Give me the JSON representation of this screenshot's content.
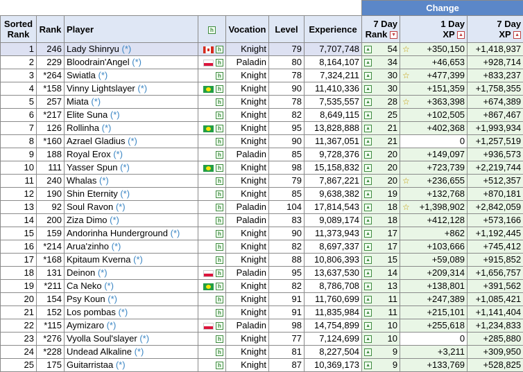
{
  "header": {
    "change": "Change",
    "sorted_rank": [
      "Sorted",
      "Rank"
    ],
    "rank": "Rank",
    "player": "Player",
    "vocation": "Vocation",
    "level": "Level",
    "experience": "Experience",
    "day7_rank": [
      "7 Day",
      "Rank"
    ],
    "day1_xp": [
      "1 Day",
      "XP"
    ],
    "day7_xp": [
      "7 Day",
      "XP"
    ]
  },
  "icons": {
    "highscore": "h-icon",
    "up": "up-arrow-icon",
    "sort": "sort-icon",
    "star": "star-icon"
  },
  "colors": {
    "change_header": "#5b87c8",
    "header_bg": "#dfe7f5",
    "selected_row": "#dde1f2",
    "green_cell": "#e9f6e6",
    "link": "#3b86c4"
  },
  "rows": [
    {
      "srank": "1",
      "rank": "246",
      "player": "Lady Shinryu",
      "star_link": "(*)",
      "flag": "ca",
      "vocation": "Knight",
      "level": "79",
      "exp": "7,707,748",
      "r7": "54",
      "star1": true,
      "xp1": "+350,150",
      "xp7": "+1,418,937",
      "sel": true
    },
    {
      "srank": "2",
      "rank": "229",
      "player": "Bloodrain'Angel",
      "star_link": "(*)",
      "flag": "pl",
      "vocation": "Paladin",
      "level": "80",
      "exp": "8,164,107",
      "r7": "34",
      "star1": false,
      "xp1": "+46,653",
      "xp7": "+928,714"
    },
    {
      "srank": "3",
      "rank": "*264",
      "player": "Swiatla",
      "star_link": "(*)",
      "flag": "",
      "vocation": "Knight",
      "level": "78",
      "exp": "7,324,211",
      "r7": "30",
      "star1": true,
      "xp1": "+477,399",
      "xp7": "+833,237"
    },
    {
      "srank": "4",
      "rank": "*158",
      "player": "Vinny Lightslayer",
      "star_link": "(*)",
      "flag": "br",
      "vocation": "Knight",
      "level": "90",
      "exp": "11,410,336",
      "r7": "30",
      "star1": false,
      "xp1": "+151,359",
      "xp7": "+1,758,355"
    },
    {
      "srank": "5",
      "rank": "257",
      "player": "Miata",
      "star_link": "(*)",
      "flag": "",
      "vocation": "Knight",
      "level": "78",
      "exp": "7,535,557",
      "r7": "28",
      "star1": true,
      "xp1": "+363,398",
      "xp7": "+674,389"
    },
    {
      "srank": "6",
      "rank": "*217",
      "player": "Elite Suna",
      "star_link": "(*)",
      "flag": "",
      "vocation": "Knight",
      "level": "82",
      "exp": "8,649,115",
      "r7": "25",
      "star1": false,
      "xp1": "+102,505",
      "xp7": "+867,467"
    },
    {
      "srank": "7",
      "rank": "126",
      "player": "Rollinha",
      "star_link": "(*)",
      "flag": "br",
      "vocation": "Knight",
      "level": "95",
      "exp": "13,828,888",
      "r7": "21",
      "star1": false,
      "xp1": "+402,368",
      "xp7": "+1,993,934"
    },
    {
      "srank": "8",
      "rank": "*160",
      "player": "Azrael Gladius",
      "star_link": "(*)",
      "flag": "",
      "vocation": "Knight",
      "level": "90",
      "exp": "11,367,051",
      "r7": "21",
      "star1": false,
      "xp1": "0",
      "xp7": "+1,257,519",
      "xp1_plain": true
    },
    {
      "srank": "9",
      "rank": "188",
      "player": "Royal Erox",
      "star_link": "(*)",
      "flag": "",
      "vocation": "Paladin",
      "level": "85",
      "exp": "9,728,376",
      "r7": "20",
      "star1": false,
      "xp1": "+149,097",
      "xp7": "+936,573"
    },
    {
      "srank": "10",
      "rank": "111",
      "player": "Yasser Spun",
      "star_link": "(*)",
      "flag": "br",
      "vocation": "Knight",
      "level": "98",
      "exp": "15,158,832",
      "r7": "20",
      "star1": false,
      "xp1": "+723,739",
      "xp7": "+2,219,744"
    },
    {
      "srank": "11",
      "rank": "240",
      "player": "Whalas",
      "star_link": "(*)",
      "flag": "",
      "vocation": "Knight",
      "level": "79",
      "exp": "7,867,221",
      "r7": "20",
      "star1": true,
      "xp1": "+236,655",
      "xp7": "+512,357"
    },
    {
      "srank": "12",
      "rank": "190",
      "player": "Shin Eternity",
      "star_link": "(*)",
      "flag": "",
      "vocation": "Knight",
      "level": "85",
      "exp": "9,638,382",
      "r7": "19",
      "star1": false,
      "xp1": "+132,768",
      "xp7": "+870,181"
    },
    {
      "srank": "13",
      "rank": "92",
      "player": "Soul Ravon",
      "star_link": "(*)",
      "flag": "",
      "vocation": "Paladin",
      "level": "104",
      "exp": "17,814,543",
      "r7": "18",
      "star1": true,
      "xp1": "+1,398,902",
      "xp7": "+2,842,059"
    },
    {
      "srank": "14",
      "rank": "200",
      "player": "Ziza Dimo",
      "star_link": "(*)",
      "flag": "",
      "vocation": "Paladin",
      "level": "83",
      "exp": "9,089,174",
      "r7": "18",
      "star1": false,
      "xp1": "+412,128",
      "xp7": "+573,166"
    },
    {
      "srank": "15",
      "rank": "159",
      "player": "Andorinha Hunderground",
      "star_link": "(*)",
      "flag": "",
      "vocation": "Knight",
      "level": "90",
      "exp": "11,373,943",
      "r7": "17",
      "star1": false,
      "xp1": "+862",
      "xp7": "+1,192,445"
    },
    {
      "srank": "16",
      "rank": "*214",
      "player": "Arua'zinho",
      "star_link": "(*)",
      "flag": "",
      "vocation": "Knight",
      "level": "82",
      "exp": "8,697,337",
      "r7": "17",
      "star1": false,
      "xp1": "+103,666",
      "xp7": "+745,412"
    },
    {
      "srank": "17",
      "rank": "*168",
      "player": "Kpitaum Kverna",
      "star_link": "(*)",
      "flag": "",
      "vocation": "Knight",
      "level": "88",
      "exp": "10,806,393",
      "r7": "15",
      "star1": false,
      "xp1": "+59,089",
      "xp7": "+915,852"
    },
    {
      "srank": "18",
      "rank": "131",
      "player": "Deinon",
      "star_link": "(*)",
      "flag": "pl",
      "vocation": "Paladin",
      "level": "95",
      "exp": "13,637,530",
      "r7": "14",
      "star1": false,
      "xp1": "+209,314",
      "xp7": "+1,656,757"
    },
    {
      "srank": "19",
      "rank": "*211",
      "player": "Ca Neko",
      "star_link": "(*)",
      "flag": "br",
      "vocation": "Knight",
      "level": "82",
      "exp": "8,786,708",
      "r7": "13",
      "star1": false,
      "xp1": "+138,801",
      "xp7": "+391,562"
    },
    {
      "srank": "20",
      "rank": "154",
      "player": "Psy Koun",
      "star_link": "(*)",
      "flag": "",
      "vocation": "Knight",
      "level": "91",
      "exp": "11,760,699",
      "r7": "11",
      "star1": false,
      "xp1": "+247,389",
      "xp7": "+1,085,421"
    },
    {
      "srank": "21",
      "rank": "152",
      "player": "Los pombas",
      "star_link": "(*)",
      "flag": "",
      "vocation": "Knight",
      "level": "91",
      "exp": "11,835,984",
      "r7": "11",
      "star1": false,
      "xp1": "+215,101",
      "xp7": "+1,141,404"
    },
    {
      "srank": "22",
      "rank": "*115",
      "player": "Aymizaro",
      "star_link": "(*)",
      "flag": "pl",
      "vocation": "Paladin",
      "level": "98",
      "exp": "14,754,899",
      "r7": "10",
      "star1": false,
      "xp1": "+255,618",
      "xp7": "+1,234,833"
    },
    {
      "srank": "23",
      "rank": "*276",
      "player": "Vyolla Soul'slayer",
      "star_link": "(*)",
      "flag": "",
      "vocation": "Knight",
      "level": "77",
      "exp": "7,124,699",
      "r7": "10",
      "star1": false,
      "xp1": "0",
      "xp7": "+285,880",
      "xp1_plain": true
    },
    {
      "srank": "24",
      "rank": "*228",
      "player": "Undead Alkaline",
      "star_link": "(*)",
      "flag": "",
      "vocation": "Knight",
      "level": "81",
      "exp": "8,227,504",
      "r7": "9",
      "star1": false,
      "xp1": "+3,211",
      "xp7": "+309,950"
    },
    {
      "srank": "25",
      "rank": "175",
      "player": "Guitarristaa",
      "star_link": "(*)",
      "flag": "",
      "vocation": "Knight",
      "level": "87",
      "exp": "10,369,173",
      "r7": "9",
      "star1": false,
      "xp1": "+133,769",
      "xp7": "+528,825"
    }
  ]
}
